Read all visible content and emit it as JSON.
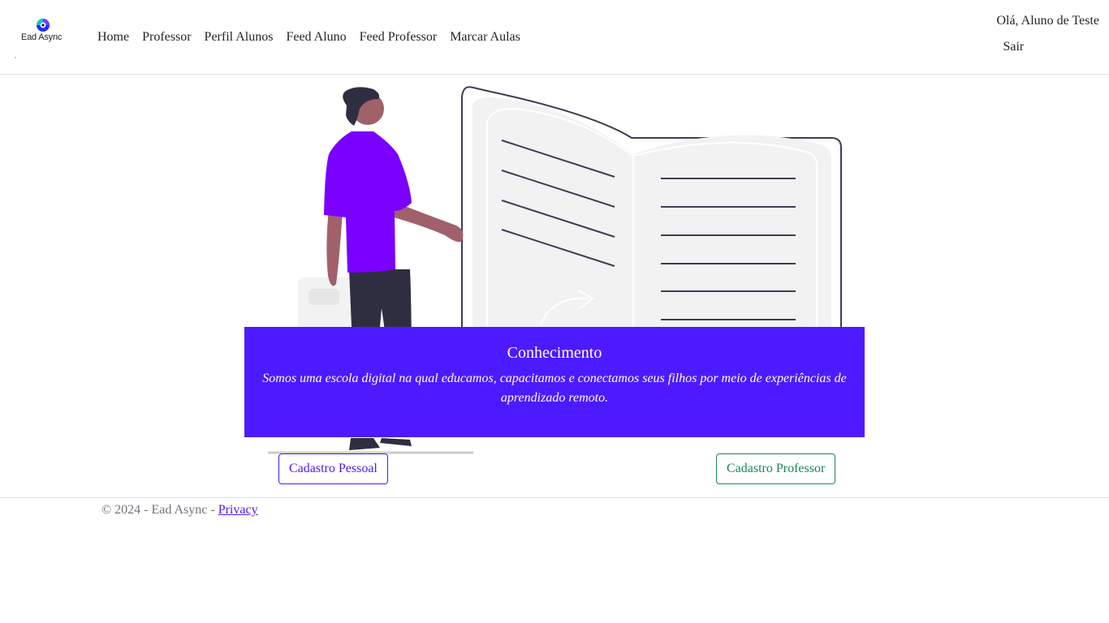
{
  "brand": {
    "logo_text": "Ead Async"
  },
  "nav": {
    "items": [
      {
        "label": "Home"
      },
      {
        "label": "Professor"
      },
      {
        "label": "Perfil Alunos"
      },
      {
        "label": "Feed Aluno"
      },
      {
        "label": "Feed Professor"
      },
      {
        "label": "Marcar Aulas"
      }
    ]
  },
  "user": {
    "greeting": "Olá, Aluno de Teste",
    "logout_label": "Sair"
  },
  "carousel": {
    "caption_title": "Conhecimento",
    "caption_text": "Somos uma escola digital na qual educamos, capacitamos e conectamos seus filhos por meio de experiências de aprendizado remoto."
  },
  "actions": {
    "personal_signup": "Cadastro Pessoal",
    "professor_signup": "Cadastro Professor"
  },
  "footer": {
    "copyright": "© 2024 - Ead Async - ",
    "privacy_label": "Privacy"
  },
  "colors": {
    "primary": "#4d1aff",
    "success": "#198754",
    "shirt": "#7a00ff",
    "skin": "#a0616a",
    "dark": "#2f2e41"
  }
}
